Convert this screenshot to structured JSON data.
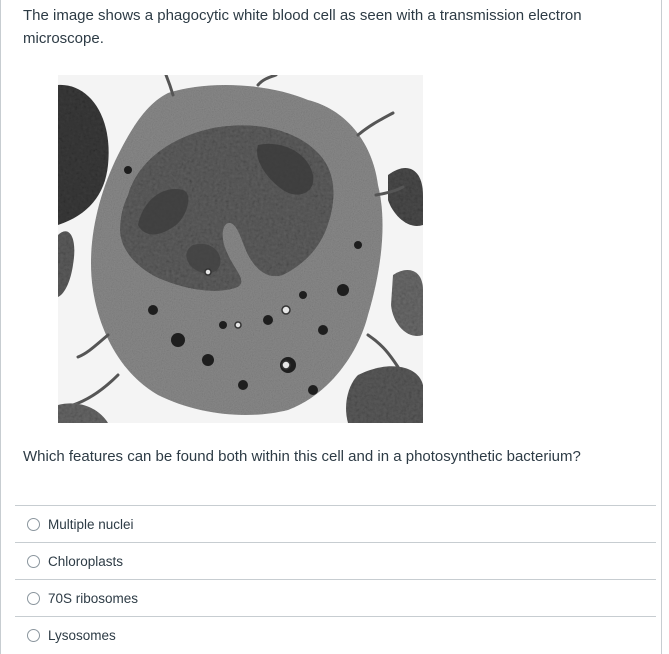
{
  "question": {
    "prompt": "The image shows a phagocytic white blood cell as seen with a transmission electron microscope.",
    "stem": "Which features can be found both within this cell and in a photosynthetic bacterium?",
    "options": [
      {
        "label": "Multiple nuclei",
        "selected": false
      },
      {
        "label": "Chloroplasts",
        "selected": false
      },
      {
        "label": "70S ribosomes",
        "selected": false
      },
      {
        "label": "Lysosomes",
        "selected": false
      }
    ]
  },
  "image": {
    "subject": "transmission electron micrograph of phagocytic white blood cell"
  }
}
